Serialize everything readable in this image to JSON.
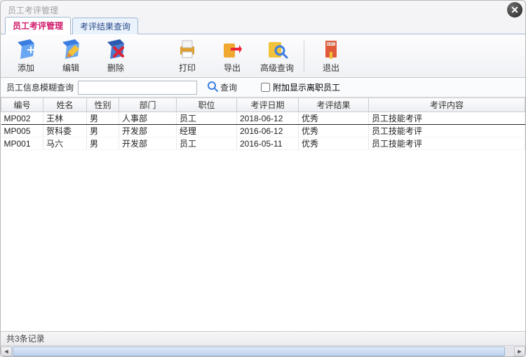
{
  "window": {
    "title": "员工考评管理"
  },
  "tabs": [
    {
      "label": "员工考评管理",
      "active": true
    },
    {
      "label": "考评结果查询",
      "active": false
    }
  ],
  "toolbar": {
    "add": "添加",
    "edit": "编辑",
    "delete": "删除",
    "print": "打印",
    "export": "导出",
    "advsearch": "高级查询",
    "exit": "退出"
  },
  "search": {
    "label": "员工信息模糊查询",
    "value": "",
    "button": "查询",
    "checkbox_label": "附加显示离职员工",
    "checkbox_checked": false
  },
  "columns": {
    "id": "编号",
    "name": "姓名",
    "gender": "性别",
    "dept": "部门",
    "pos": "职位",
    "date": "考评日期",
    "result": "考评结果",
    "content": "考评内容"
  },
  "rows": [
    {
      "id": "MP002",
      "name": "王林",
      "gender": "男",
      "dept": "人事部",
      "pos": "员工",
      "date": "2018-06-12",
      "result": "优秀",
      "content": "员工技能考评"
    },
    {
      "id": "MP005",
      "name": "贺科委",
      "gender": "男",
      "dept": "开发部",
      "pos": "经理",
      "date": "2016-06-12",
      "result": "优秀",
      "content": "员工技能考评"
    },
    {
      "id": "MP001",
      "name": "马六",
      "gender": "男",
      "dept": "开发部",
      "pos": "员工",
      "date": "2016-05-11",
      "result": "优秀",
      "content": "员工技能考评"
    }
  ],
  "status": {
    "text": "共3条记录"
  }
}
